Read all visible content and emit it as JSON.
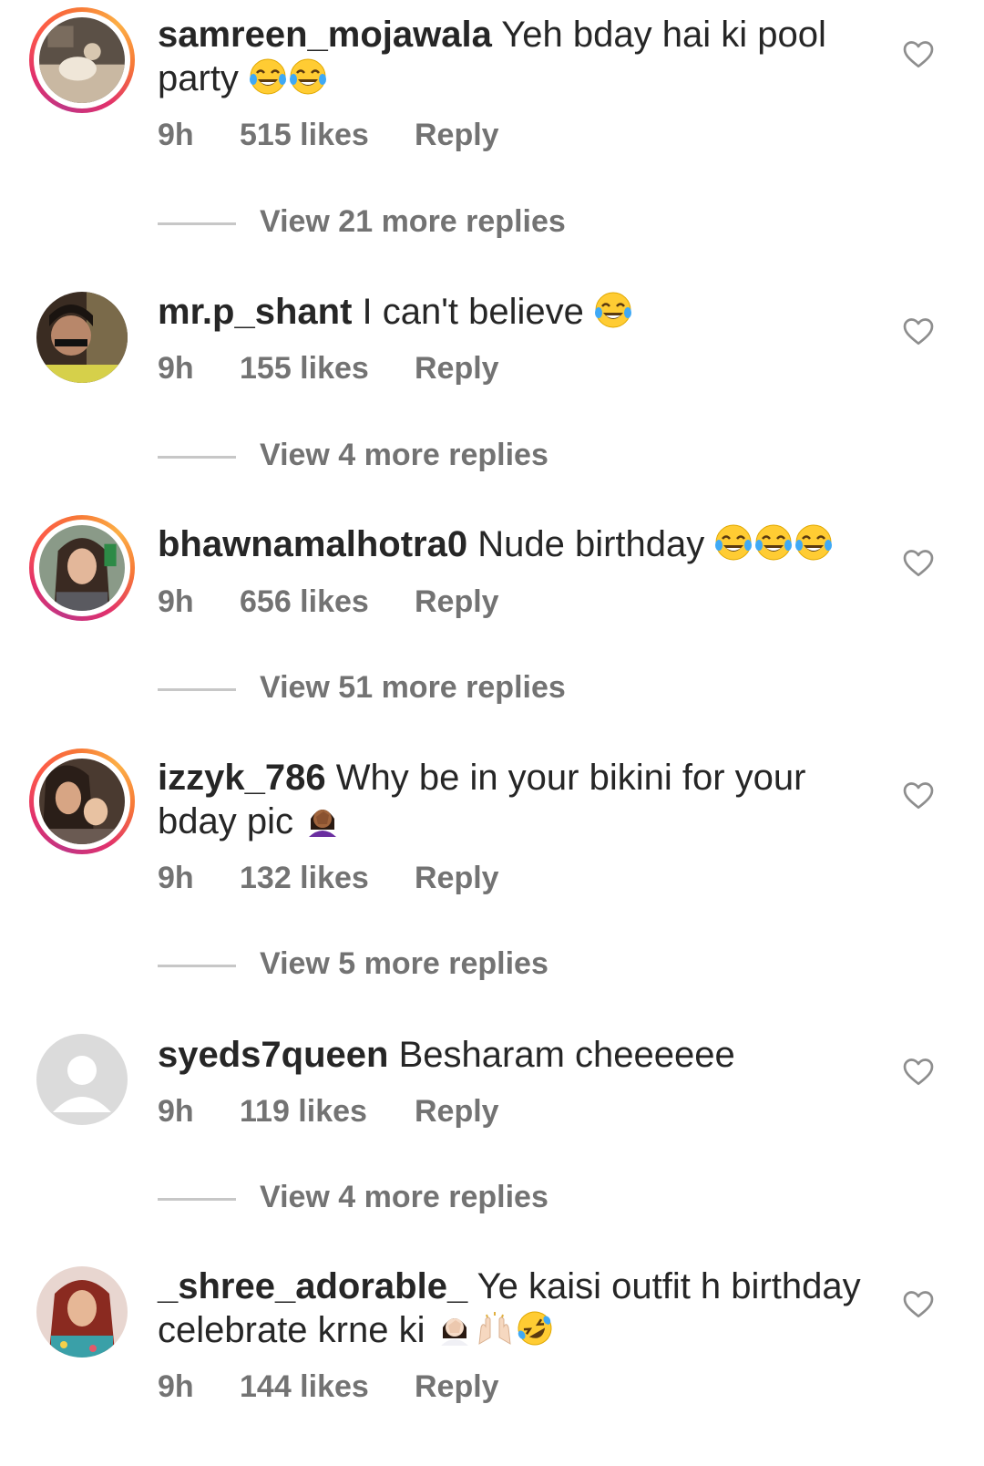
{
  "comments": [
    {
      "username": "samreen_mojawala",
      "text": "Yeh bday hai ki pool party",
      "emojis": [
        "face-with-tears-of-joy",
        "face-with-tears-of-joy"
      ],
      "time": "9h",
      "likes": "515 likes",
      "reply": "Reply",
      "view_replies": "View 21 more replies",
      "has_story_ring": true
    },
    {
      "username": "mr.p_shant",
      "text": "I can't believe",
      "emojis": [
        "face-with-tears-of-joy"
      ],
      "time": "9h",
      "likes": "155 likes",
      "reply": "Reply",
      "view_replies": "View 4 more replies",
      "has_story_ring": false
    },
    {
      "username": "bhawnamalhotra0",
      "text": "Nude birthday",
      "emojis": [
        "face-with-tears-of-joy",
        "face-with-tears-of-joy",
        "face-with-tears-of-joy"
      ],
      "time": "9h",
      "likes": "656 likes",
      "reply": "Reply",
      "view_replies": "View 51 more replies",
      "has_story_ring": true
    },
    {
      "username": "izzyk_786",
      "text": "Why be in your bikini for your bday pic",
      "emojis": [
        "woman-facepalming"
      ],
      "time": "9h",
      "likes": "132 likes",
      "reply": "Reply",
      "view_replies": "View 5 more replies",
      "has_story_ring": true
    },
    {
      "username": "syeds7queen",
      "text": "Besharam cheeeeee",
      "emojis": [],
      "time": "9h",
      "likes": "119 likes",
      "reply": "Reply",
      "view_replies": "View 4 more replies",
      "has_story_ring": false
    },
    {
      "username": "_shree_adorable_",
      "text": "Ye kaisi outfit h birthday celebrate krne ki",
      "emojis": [
        "woman-facepalming",
        "raising-hands",
        "rolling-on-the-floor-laughing"
      ],
      "time": "9h",
      "likes": "144 likes",
      "reply": "Reply",
      "view_replies": "",
      "has_story_ring": false
    }
  ],
  "colors": {
    "text": "#262626",
    "secondary": "#737373",
    "divider": "#c7c7c7",
    "story_ring_start": "#c13584",
    "story_ring_end": "#fcaf45"
  }
}
